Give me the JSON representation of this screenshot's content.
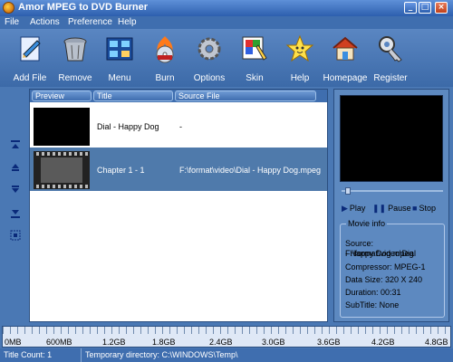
{
  "window": {
    "title": "Amor MPEG to DVD Burner"
  },
  "menu": [
    "File",
    "Actions",
    "Preference",
    "Help"
  ],
  "toolbar": [
    "Add File",
    "Remove",
    "Menu",
    "Burn",
    "Options",
    "Skin",
    "Help",
    "Homepage",
    "Register"
  ],
  "list": {
    "columns": [
      "Preview",
      "Title",
      "Source File"
    ],
    "rows": [
      {
        "title": "Dial - Happy Dog",
        "source": "-"
      },
      {
        "title": "Chapter 1 - 1",
        "source": "F:\\format\\video\\Dial - Happy Dog.mpeg"
      }
    ]
  },
  "player": {
    "play": "Play",
    "pause": "Pause",
    "stop": "Stop"
  },
  "movie_info": {
    "legend": "Movie info",
    "source_line1": "Source: F:\\format\\video\\Dial",
    "source_line2": "- Happy Dog.mpeg",
    "compressor": "Compressor: MPEG-1",
    "data_size": "Data Size: 320 X 240",
    "duration": "Duration: 00:31",
    "subtitle": "SubTitle: None"
  },
  "size_scale": [
    "0MB",
    "600MB",
    "1.2GB",
    "1.8GB",
    "2.4GB",
    "3.0GB",
    "3.6GB",
    "4.2GB",
    "4.8GB"
  ],
  "status": {
    "title_count": "Title Count: 1",
    "temp_dir": "Temporary directory: C:\\WINDOWS\\Temp\\"
  }
}
